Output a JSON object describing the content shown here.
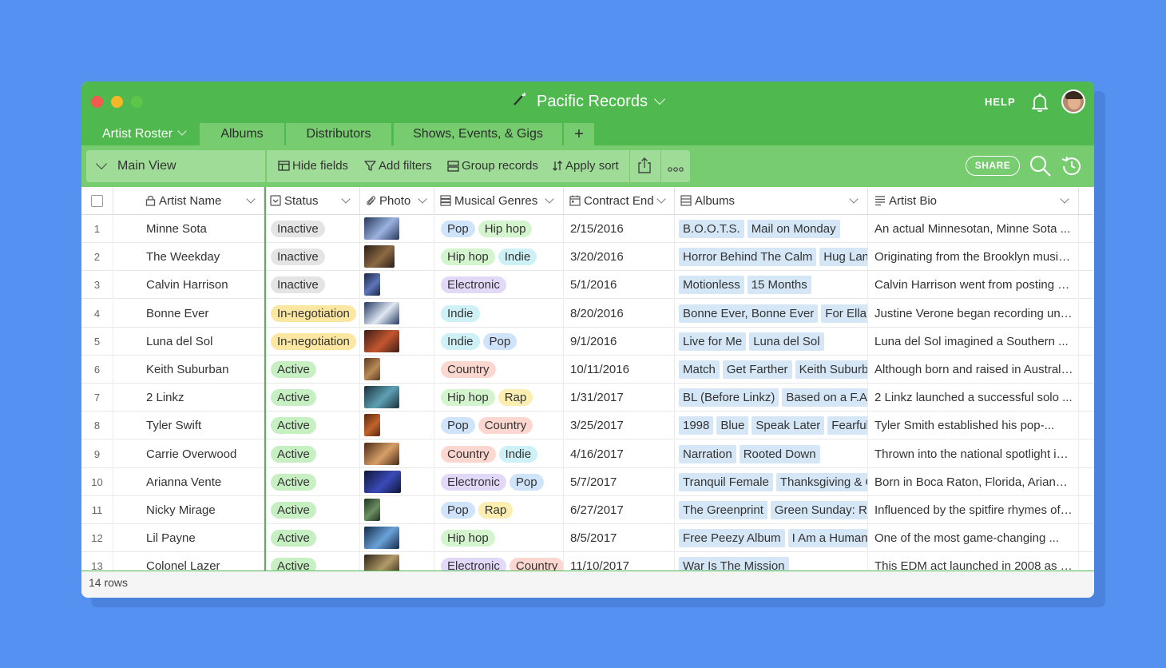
{
  "window": {
    "title": "Pacific Records",
    "help_label": "HELP"
  },
  "tabs": [
    {
      "label": "Artist Roster"
    },
    {
      "label": "Albums"
    },
    {
      "label": "Distributors"
    },
    {
      "label": "Shows, Events, & Gigs"
    },
    {
      "label": "+"
    }
  ],
  "toolbar": {
    "view_label": "Main View",
    "hide_fields": "Hide fields",
    "add_filters": "Add filters",
    "group_records": "Group records",
    "apply_sort": "Apply sort",
    "share_label": "SHARE"
  },
  "columns": {
    "name": "Artist Name",
    "status": "Status",
    "photo": "Photo",
    "genres": "Musical Genres",
    "contract": "Contract End",
    "albums": "Albums",
    "bio": "Artist Bio"
  },
  "colors": {
    "brand_green": "#4fb84e",
    "status_inactive": "#e4e4e4",
    "status_negotiation": "#fbe7a2",
    "status_active": "#c6efc2",
    "genre_pop": "#cfe3fb",
    "genre_hiphop": "#d3f4cd",
    "genre_indie": "#cdf1f6",
    "genre_electronic": "#e2d8f8",
    "genre_country": "#fcd7d0",
    "genre_rap": "#fbeeb0"
  },
  "rows": [
    {
      "num": "1",
      "name": "Minne Sota",
      "status": "Inactive",
      "genres": [
        "Pop",
        "Hip hop"
      ],
      "contract": "2/15/2016",
      "albums": [
        "B.O.O.T.S.",
        "Mail on Monday"
      ],
      "bio": "An actual Minnesotan, Minne Sota ..."
    },
    {
      "num": "2",
      "name": "The Weekday",
      "status": "Inactive",
      "genres": [
        "Hip hop",
        "Indie"
      ],
      "contract": "3/20/2016",
      "albums": [
        "Horror Behind The Calm",
        "Hug Land"
      ],
      "bio": "Originating from the Brooklyn music ..."
    },
    {
      "num": "3",
      "name": "Calvin Harrison",
      "status": "Inactive",
      "genres": [
        "Electronic"
      ],
      "contract": "5/1/2016",
      "albums": [
        "Motionless",
        "15 Months"
      ],
      "bio": "Calvin Harrison went from posting hi..."
    },
    {
      "num": "4",
      "name": "Bonne Ever",
      "status": "In-negotiation",
      "genres": [
        "Indie"
      ],
      "contract": "8/20/2016",
      "albums": [
        "Bonne Ever, Bonne Ever",
        "For Ella, F"
      ],
      "bio": "Justine Verone began recording und..."
    },
    {
      "num": "5",
      "name": "Luna del Sol",
      "status": "In-negotiation",
      "genres": [
        "Indie",
        "Pop"
      ],
      "contract": "9/1/2016",
      "albums": [
        "Live for Me",
        "Luna del Sol"
      ],
      "bio": "Luna del Sol imagined a Southern ..."
    },
    {
      "num": "6",
      "name": "Keith Suburban",
      "status": "Active",
      "genres": [
        "Country"
      ],
      "contract": "10/11/2016",
      "albums": [
        "Match",
        "Get Farther",
        "Keith Suburba"
      ],
      "bio": "Although born and raised in Australia..."
    },
    {
      "num": "7",
      "name": "2 Linkz",
      "status": "Active",
      "genres": [
        "Hip hop",
        "Rap"
      ],
      "contract": "1/31/2017",
      "albums": [
        "BL (Before Linkz)",
        "Based on a F.A.L"
      ],
      "bio": "2 Linkz launched a successful solo ..."
    },
    {
      "num": "8",
      "name": "Tyler Swift",
      "status": "Active",
      "genres": [
        "Pop",
        "Country"
      ],
      "contract": "3/25/2017",
      "albums": [
        "1998",
        "Blue",
        "Speak Later",
        "Fearful"
      ],
      "bio": "Tyler Smith established his pop-..."
    },
    {
      "num": "9",
      "name": "Carrie Overwood",
      "status": "Active",
      "genres": [
        "Country",
        "Indie"
      ],
      "contract": "4/16/2017",
      "albums": [
        "Narration",
        "Rooted Down"
      ],
      "bio": "Thrown into the national spotlight in ..."
    },
    {
      "num": "10",
      "name": "Arianna Vente",
      "status": "Active",
      "genres": [
        "Electronic",
        "Pop"
      ],
      "contract": "5/7/2017",
      "albums": [
        "Tranquil Female",
        "Thanksgiving & Ch"
      ],
      "bio": "Born in Boca Raton, Florida, Arianna..."
    },
    {
      "num": "11",
      "name": "Nicky Mirage",
      "status": "Active",
      "genres": [
        "Pop",
        "Rap"
      ],
      "contract": "6/27/2017",
      "albums": [
        "The Greenprint",
        "Green Sunday: Rel"
      ],
      "bio": "Influenced by the spitfire rhymes of ..."
    },
    {
      "num": "12",
      "name": "Lil Payne",
      "status": "Active",
      "genres": [
        "Hip hop"
      ],
      "contract": "8/5/2017",
      "albums": [
        "Free Peezy Album",
        "I Am a Human B"
      ],
      "bio": "One of the most game-changing ..."
    },
    {
      "num": "13",
      "name": "Colonel Lazer",
      "status": "Active",
      "genres": [
        "Electronic",
        "Country"
      ],
      "contract": "11/10/2017",
      "albums": [
        "War Is The Mission"
      ],
      "bio": "This EDM act launched in 2008 as th..."
    }
  ],
  "footer": {
    "row_count": "14 rows"
  }
}
